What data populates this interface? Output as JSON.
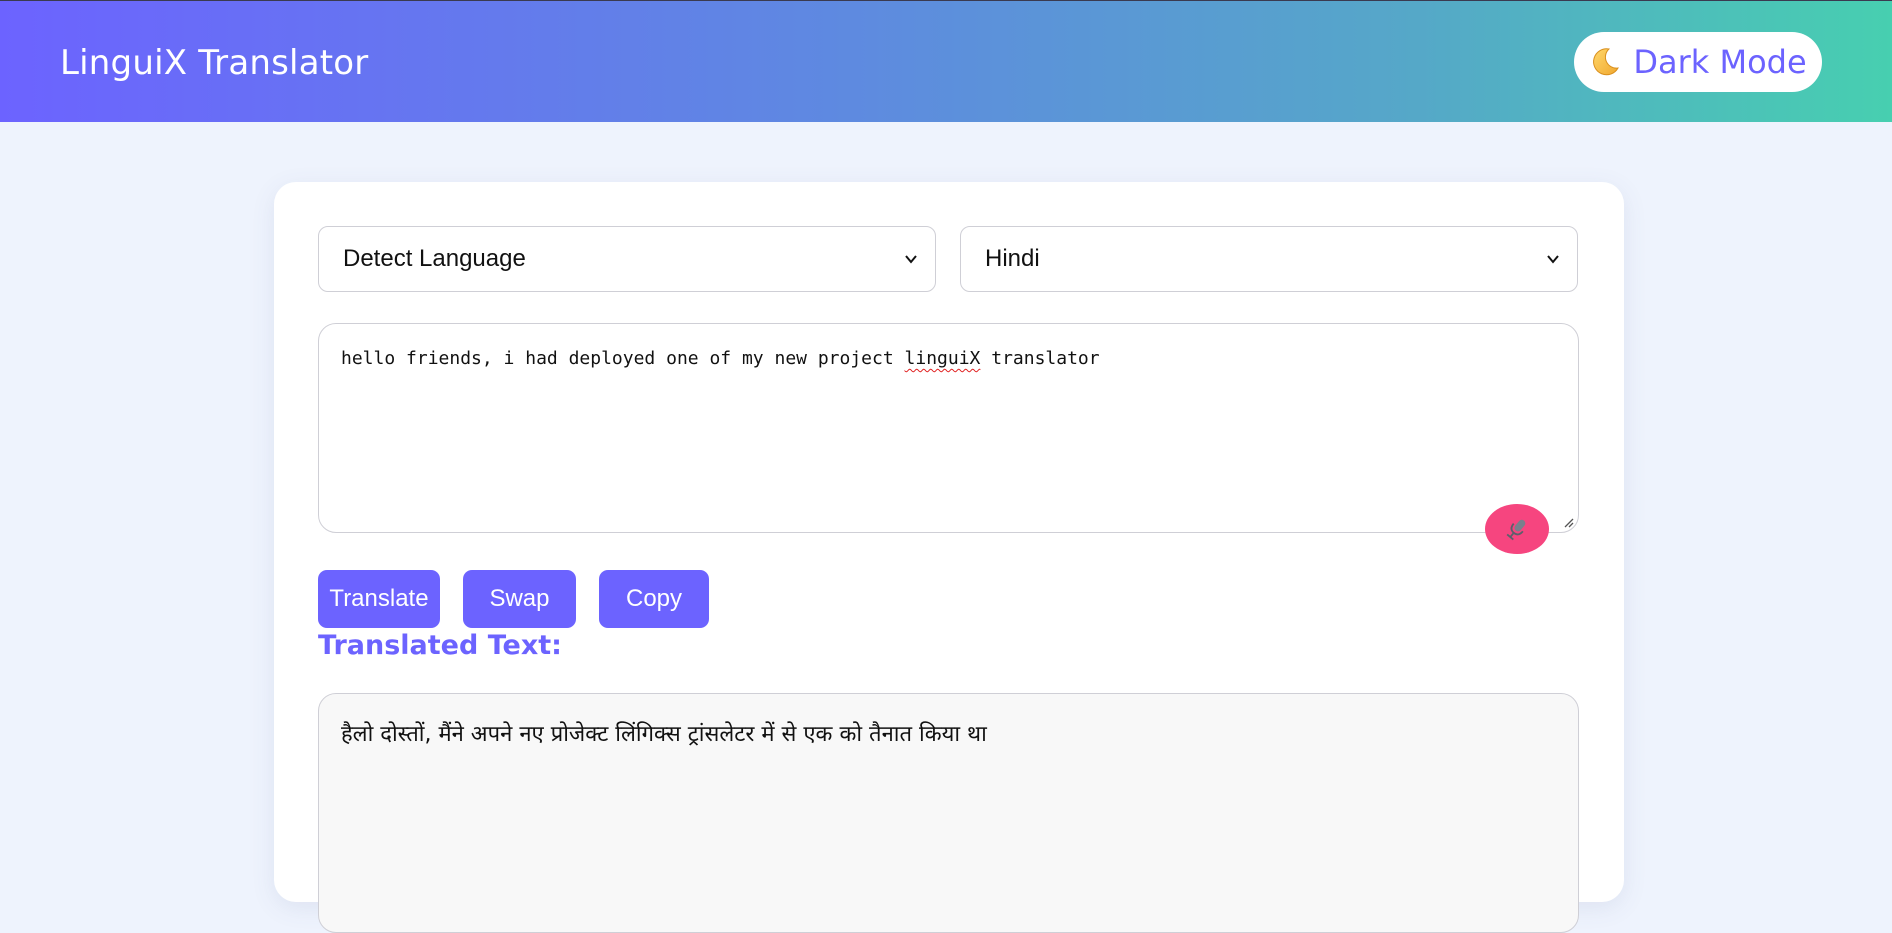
{
  "header": {
    "title": "LinguiX Translator",
    "dark_mode_label": "Dark Mode",
    "dark_mode_icon": "moon-icon"
  },
  "source_language": {
    "selected": "Detect Language"
  },
  "target_language": {
    "selected": "Hindi"
  },
  "input": {
    "text_before": "hello friends, i had deployed one of my new project ",
    "misspelled_word": "linguiX",
    "text_after": " translator",
    "mic_icon": "microphone-icon"
  },
  "actions": {
    "translate_label": "Translate",
    "swap_label": "Swap",
    "copy_label": "Copy"
  },
  "output": {
    "label": "Translated Text:",
    "text": "हैलो दोस्तों, मैंने अपने नए प्रोजेक्ट लिंगिक्स ट्रांसलेटर में से एक को तैनात किया था"
  },
  "colors": {
    "accent": "#6c63ff",
    "mic": "#f6457f",
    "gradient_start": "#6c63ff",
    "gradient_end": "#47cfb0",
    "page_bg": "#eef3fd"
  }
}
